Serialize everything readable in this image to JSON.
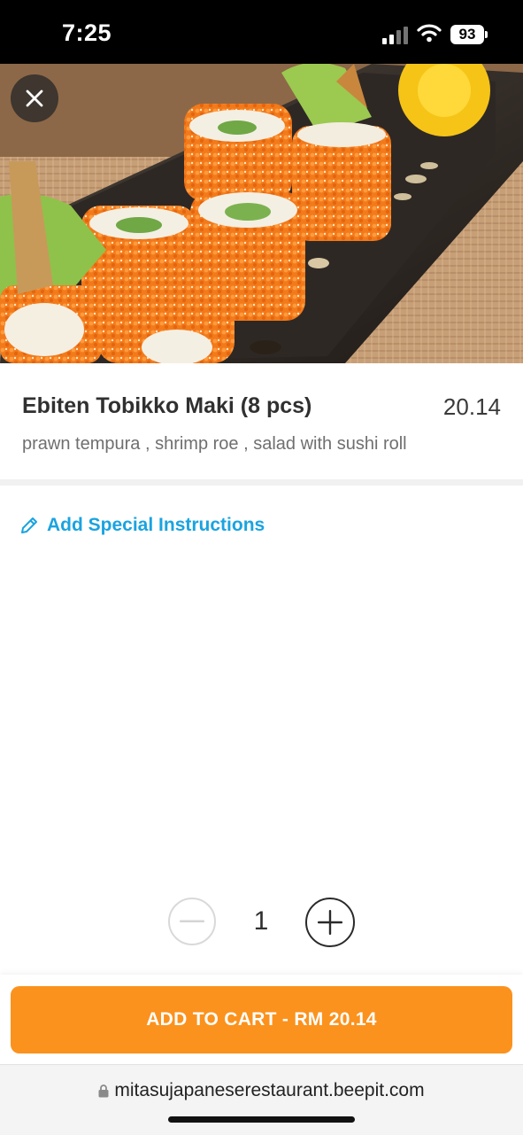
{
  "status_bar": {
    "time": "7:25",
    "battery": "93"
  },
  "product": {
    "title": "Ebiten Tobikko Maki (8 pcs)",
    "price": "20.14",
    "description": "prawn tempura , shrimp roe , salad with sushi roll"
  },
  "special_instructions": {
    "label": "Add Special Instructions"
  },
  "quantity": {
    "value": "1"
  },
  "cart": {
    "button_label": "ADD TO CART - RM 20.14"
  },
  "browser": {
    "url": "mitasujapaneserestaurant.beepit.com"
  },
  "icons": {
    "close": "close-icon",
    "pencil": "pencil-icon",
    "minus": "minus-icon",
    "plus": "plus-icon",
    "lock": "lock-icon"
  },
  "colors": {
    "accent_orange": "#fb921d",
    "link_blue": "#1aa3e0"
  }
}
